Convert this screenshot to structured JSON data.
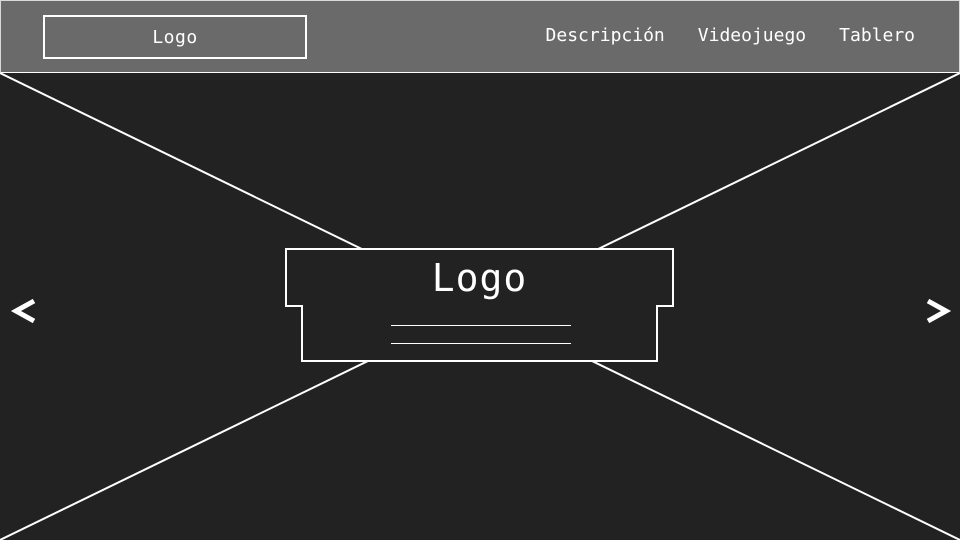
{
  "header": {
    "logo_label": "Logo",
    "nav": [
      {
        "label": "Descripción"
      },
      {
        "label": "Videojuego"
      },
      {
        "label": "Tablero"
      }
    ]
  },
  "hero": {
    "logo_label": "Logo",
    "prev_icon": "chevron-left-icon",
    "next_icon": "chevron-right-icon"
  },
  "colors": {
    "header_bg": "#6a6a6a",
    "page_bg": "#222222",
    "stroke": "#ffffff"
  }
}
